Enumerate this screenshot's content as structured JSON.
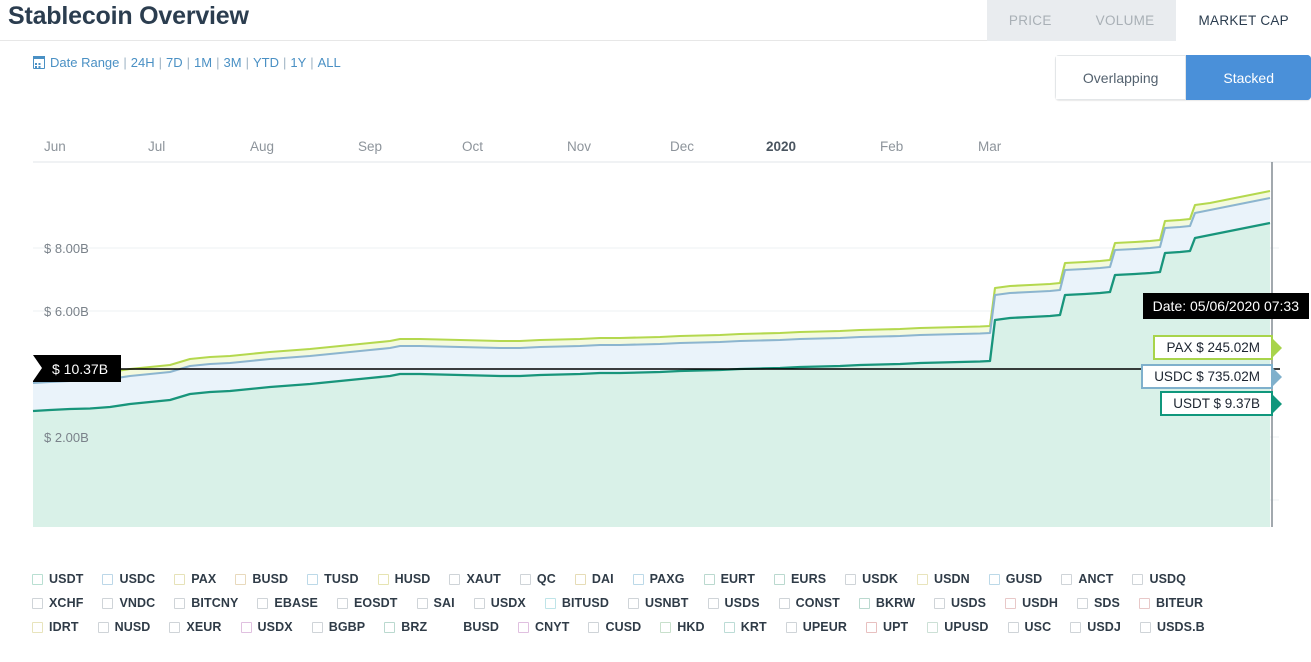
{
  "header": {
    "title": "Stablecoin Overview",
    "tabs": [
      {
        "label": "PRICE",
        "active": false
      },
      {
        "label": "VOLUME",
        "active": false
      },
      {
        "label": "MARKET CAP",
        "active": true
      }
    ]
  },
  "controls": {
    "date_range_label": "Date Range",
    "calendar_icon": "calendar-icon",
    "ranges": [
      "24H",
      "7D",
      "1M",
      "3M",
      "YTD",
      "1Y",
      "ALL"
    ],
    "separator": "|",
    "view_modes": [
      {
        "label": "Overlapping",
        "selected": false
      },
      {
        "label": "Stacked",
        "selected": true
      }
    ]
  },
  "chart_annotations": {
    "tooltip_date": "Date: 05/06/2020 07:33",
    "total_marker": "$ 10.37B",
    "callouts": [
      {
        "label": "PAX $ 245.02M",
        "color": "#a8d44b"
      },
      {
        "label": "USDC $ 735.02M",
        "color": "#7fb0cc"
      },
      {
        "label": "USDT $ 9.37B",
        "color": "#10977c"
      }
    ]
  },
  "chart_data": {
    "type": "area",
    "stacked": true,
    "title": "Stablecoin Overview",
    "xlabel": "",
    "ylabel": "",
    "grid": true,
    "legend_position": "bottom",
    "xlim": [
      "Jun",
      "Apr"
    ],
    "ylim": [
      0,
      10.37
    ],
    "ytick_labels": [
      "$ 8.00B",
      "$ 6.00B",
      "$ 4.00B",
      "$ 2.00B"
    ],
    "ytick_values": [
      8.0,
      6.0,
      4.0,
      2.0
    ],
    "xtick_labels": [
      "Jun",
      "Jul",
      "Aug",
      "Sep",
      "Oct",
      "Nov",
      "Dec",
      "2020",
      "Feb",
      "Mar"
    ],
    "xtick_emphasis": "2020",
    "units": "USD billions",
    "series": [
      {
        "name": "USDT",
        "color": "#10977c",
        "fill": "#d6f0e6",
        "final_value": 9.37,
        "final_label": "$ 9.37B",
        "values": [
          3.15,
          3.18,
          3.2,
          3.24,
          3.28,
          3.32,
          3.38,
          3.42,
          3.45,
          3.48,
          3.5,
          3.54,
          3.58,
          3.62,
          3.66,
          3.7,
          3.72,
          3.74,
          3.76,
          3.78,
          3.8,
          3.81,
          3.82,
          3.83,
          3.84,
          3.85,
          3.86,
          3.86,
          3.87,
          3.88,
          3.89,
          3.9,
          3.92,
          3.94,
          3.96,
          3.98,
          4.0,
          4.02,
          4.04,
          4.06,
          4.08,
          4.1,
          4.12,
          4.14,
          4.16,
          4.18,
          4.2,
          4.22,
          4.6,
          5.0,
          5.02,
          5.05,
          5.08,
          5.6,
          5.62,
          5.64,
          6.2,
          6.22,
          6.24,
          6.8,
          6.82,
          7.5,
          8.4,
          8.8,
          9.0,
          9.2,
          9.37
        ]
      },
      {
        "name": "USDC",
        "color": "#7fb0cc",
        "fill": "#e8f2fa",
        "final_value": 0.735,
        "final_label": "$ 735.02M",
        "values": [
          0.42,
          0.42,
          0.43,
          0.43,
          0.44,
          0.44,
          0.45,
          0.45,
          0.45,
          0.46,
          0.46,
          0.46,
          0.46,
          0.47,
          0.47,
          0.47,
          0.48,
          0.48,
          0.48,
          0.49,
          0.49,
          0.49,
          0.49,
          0.5,
          0.5,
          0.5,
          0.5,
          0.51,
          0.51,
          0.51,
          0.51,
          0.52,
          0.52,
          0.52,
          0.53,
          0.53,
          0.53,
          0.54,
          0.54,
          0.54,
          0.55,
          0.55,
          0.55,
          0.56,
          0.56,
          0.56,
          0.57,
          0.57,
          0.58,
          0.59,
          0.6,
          0.61,
          0.62,
          0.63,
          0.64,
          0.65,
          0.66,
          0.67,
          0.68,
          0.69,
          0.7,
          0.71,
          0.71,
          0.72,
          0.72,
          0.73,
          0.735
        ]
      },
      {
        "name": "PAX",
        "color": "#a8d44b",
        "fill": "#f2f9dd",
        "final_value": 0.24502,
        "final_label": "$ 245.02M",
        "values": [
          0.18,
          0.18,
          0.18,
          0.18,
          0.19,
          0.19,
          0.19,
          0.19,
          0.19,
          0.2,
          0.2,
          0.2,
          0.2,
          0.2,
          0.2,
          0.21,
          0.21,
          0.21,
          0.21,
          0.21,
          0.21,
          0.21,
          0.22,
          0.22,
          0.22,
          0.22,
          0.22,
          0.22,
          0.22,
          0.22,
          0.22,
          0.22,
          0.22,
          0.23,
          0.23,
          0.23,
          0.23,
          0.23,
          0.23,
          0.23,
          0.23,
          0.23,
          0.23,
          0.23,
          0.24,
          0.24,
          0.24,
          0.24,
          0.24,
          0.24,
          0.24,
          0.24,
          0.24,
          0.24,
          0.24,
          0.24,
          0.24,
          0.24,
          0.24,
          0.24,
          0.24,
          0.245,
          0.245,
          0.245,
          0.245,
          0.245,
          0.24502
        ]
      }
    ],
    "total_final": 10.37,
    "total_final_label": "$ 10.37B"
  },
  "legend": {
    "rows": [
      [
        "USDT",
        "USDC",
        "PAX",
        "BUSD",
        "TUSD",
        "HUSD",
        "XAUT",
        "QC",
        "DAI",
        "PAXG",
        "EURT",
        "EURS",
        "USDK",
        "USDN",
        "GUSD",
        "ANCT",
        "USDQ"
      ],
      [
        "XCHF",
        "VNDC",
        "BITCNY",
        "EBASE",
        "EOSDT",
        "SAI",
        "USDX",
        "BITUSD",
        "USNBT",
        "USDS",
        "CONST",
        "BKRW",
        "USDS",
        "USDH",
        "SDS",
        "BITEUR"
      ],
      [
        "IDRT",
        "NUSD",
        "XEUR",
        "USDX",
        "BGBP",
        "BRZ",
        "BUSD",
        "CNYT",
        "CUSD",
        "HKD",
        "KRT",
        "UPEUR",
        "UPT",
        "UPUSD",
        "USC",
        "USDJ",
        "USDS.B"
      ]
    ],
    "box_colors": [
      [
        "#b9dfd2",
        "#bcd7e8",
        "#e6e2b8",
        "#e8d9bc",
        "#bcd9e8",
        "#e6e4b2",
        "#cfd4d8",
        "#cfd4d8",
        "#e6dcb6",
        "#bcd9e8",
        "#bad9cf",
        "#bad9cf",
        "#cfd4d8",
        "#e8e4bc",
        "#bcd9e8",
        "#cfd4d8",
        "#cfd4d8"
      ],
      [
        "#cfd4d8",
        "#cfd4d8",
        "#cfd4d8",
        "#cfd4d8",
        "#cfd4d8",
        "#cfd4d8",
        "#cfd4d8",
        "#bfe4e8",
        "#cfd4d8",
        "#cfd4d8",
        "#cfd4d8",
        "#bad9cf",
        "#cfd4d8",
        "#e8c8c8",
        "#cfd4d8",
        "#e8c8c8"
      ],
      [
        "#e8e4bc",
        "#cfd4d8",
        "#cfd4d8",
        "#e0c0e0",
        "#cfd4d8",
        "#bad9cf",
        "#ffffff",
        "#e0c0e0",
        "#cfd4d8",
        "#c8e0cc",
        "#bcdcd6",
        "#cfd4d8",
        "#e8c0c0",
        "#cce0d6",
        "#cfd4d8",
        "#cfd4d8",
        "#cfd4d8"
      ]
    ]
  }
}
